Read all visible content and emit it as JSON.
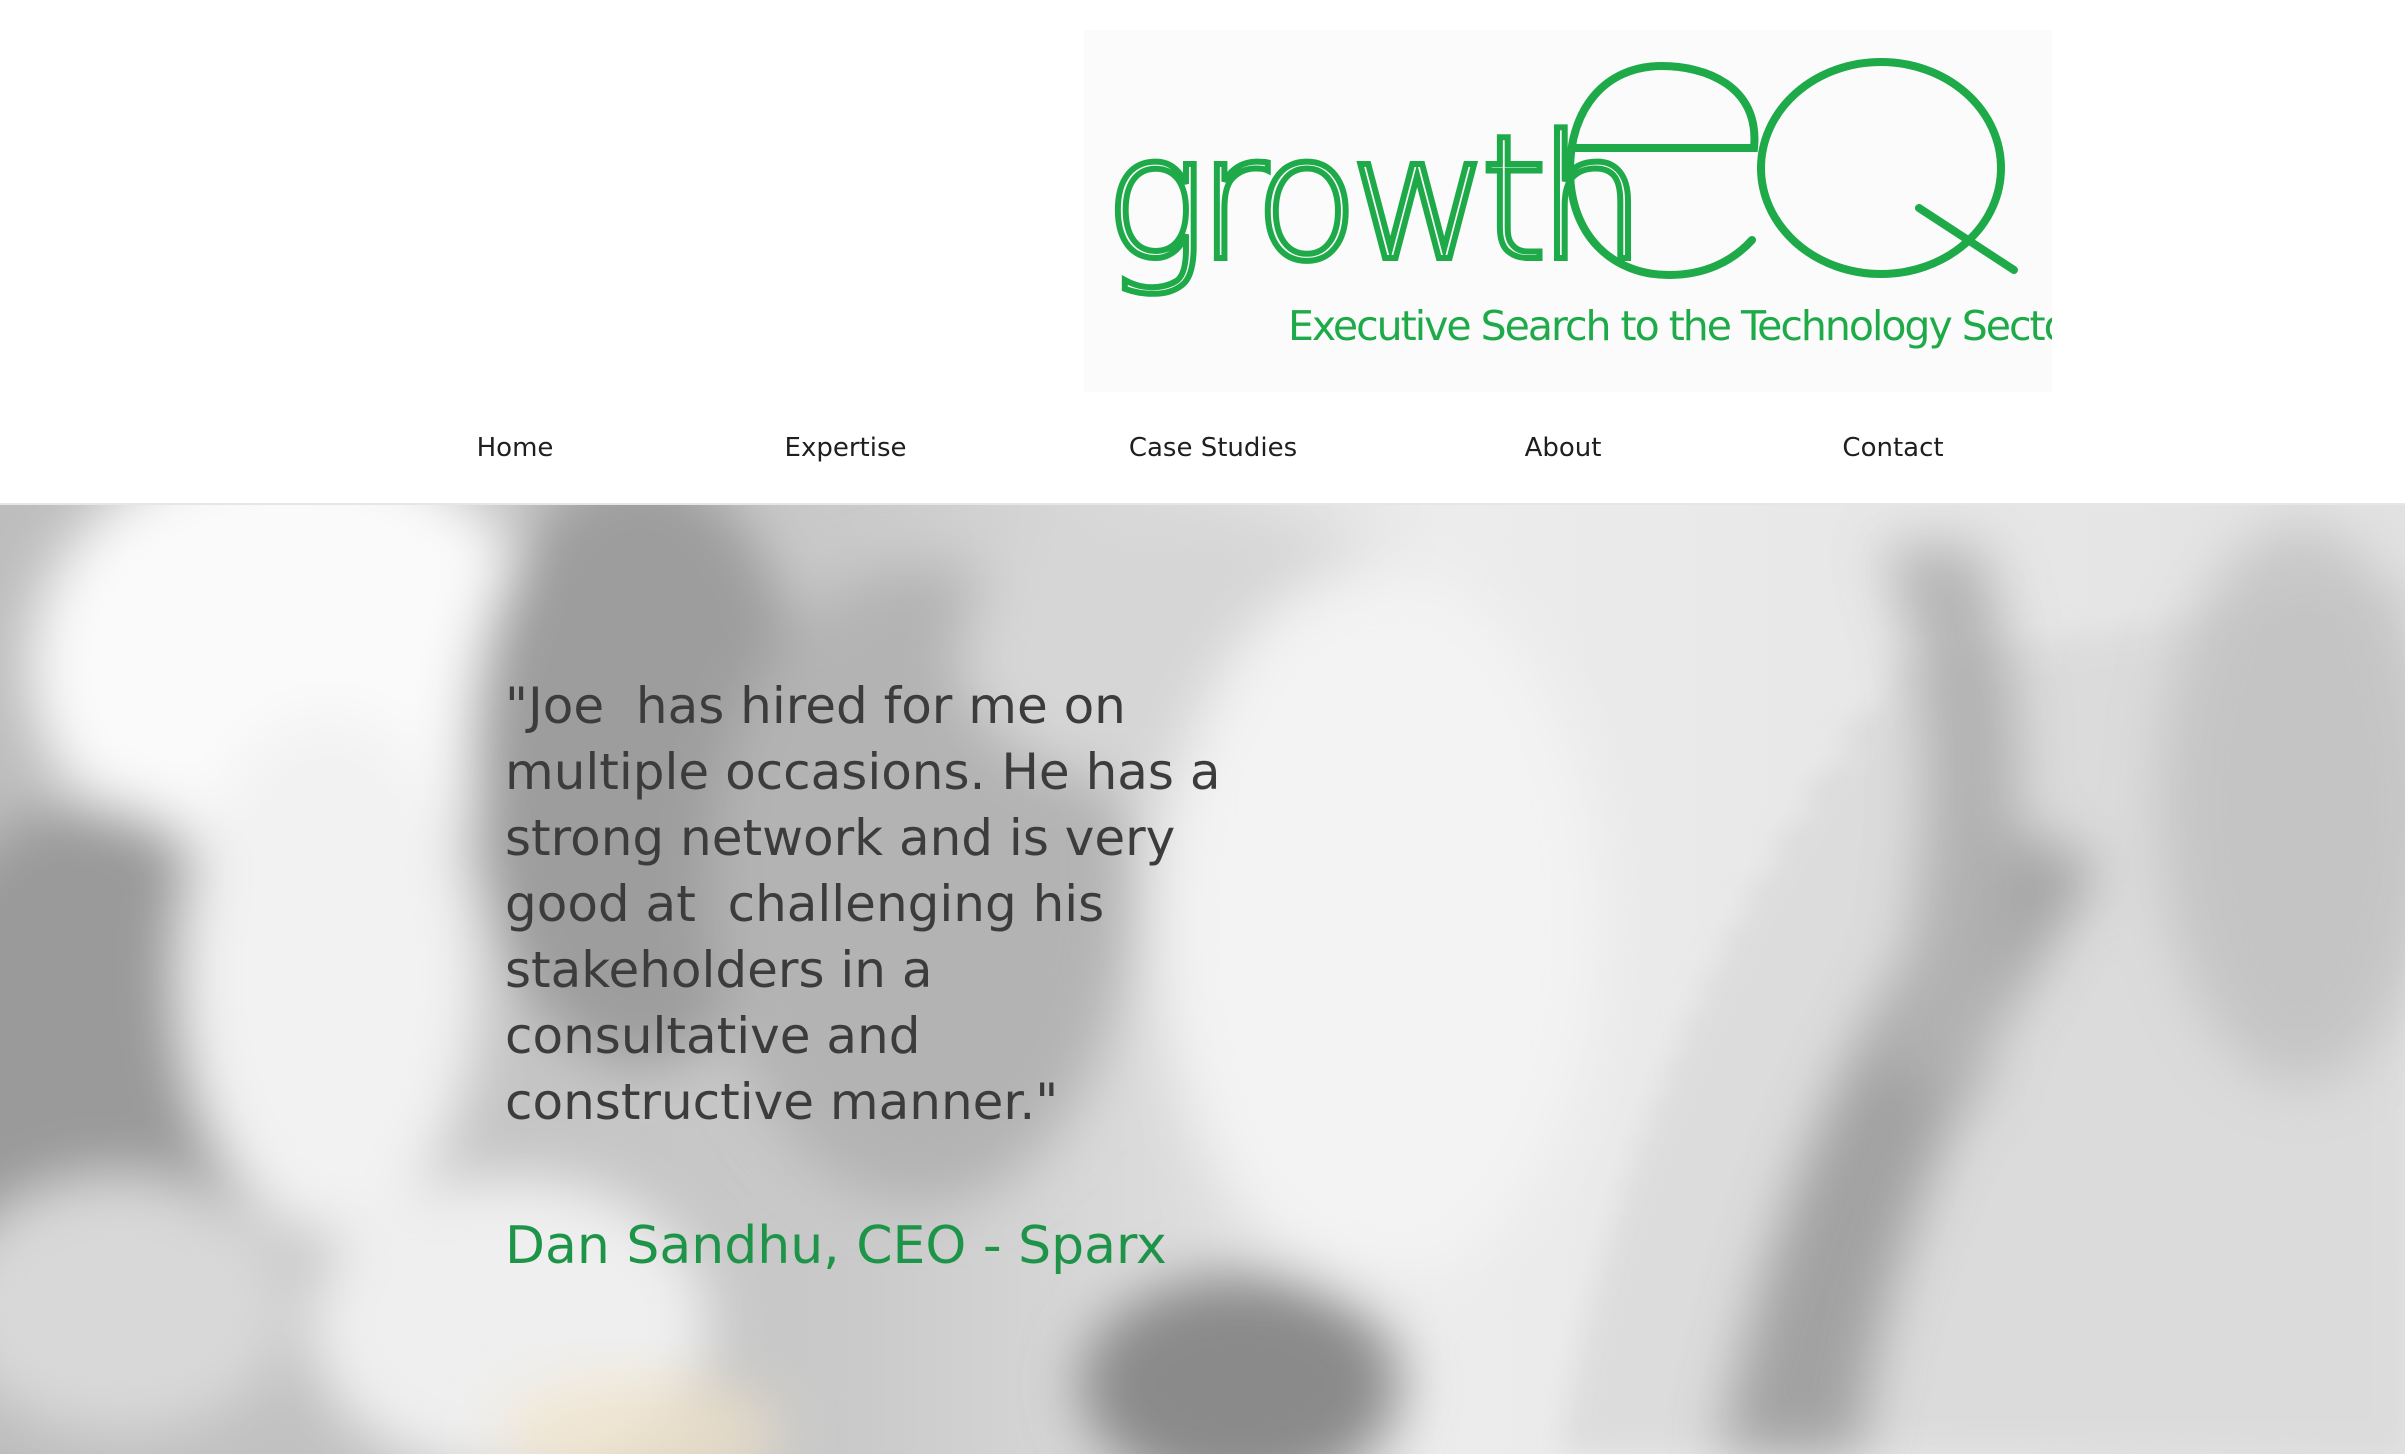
{
  "brand": {
    "logo_word": "growth",
    "logo_mark": "eQ",
    "tagline": "Executive Search to the Technology Sector",
    "accent_color": "#1faa4a"
  },
  "nav": {
    "items": [
      {
        "label": "Home"
      },
      {
        "label": "Expertise"
      },
      {
        "label": "Case Studies"
      },
      {
        "label": "About"
      },
      {
        "label": "Contact"
      }
    ]
  },
  "testimonial": {
    "quote": "\"Joe  has hired for me on multiple occasions. He has a strong network and is very good at  challenging his stakeholders in a consultative and constructive manner.\"",
    "author": "Dan Sandhu, CEO - Sparx",
    "author_color": "#1e9448"
  }
}
